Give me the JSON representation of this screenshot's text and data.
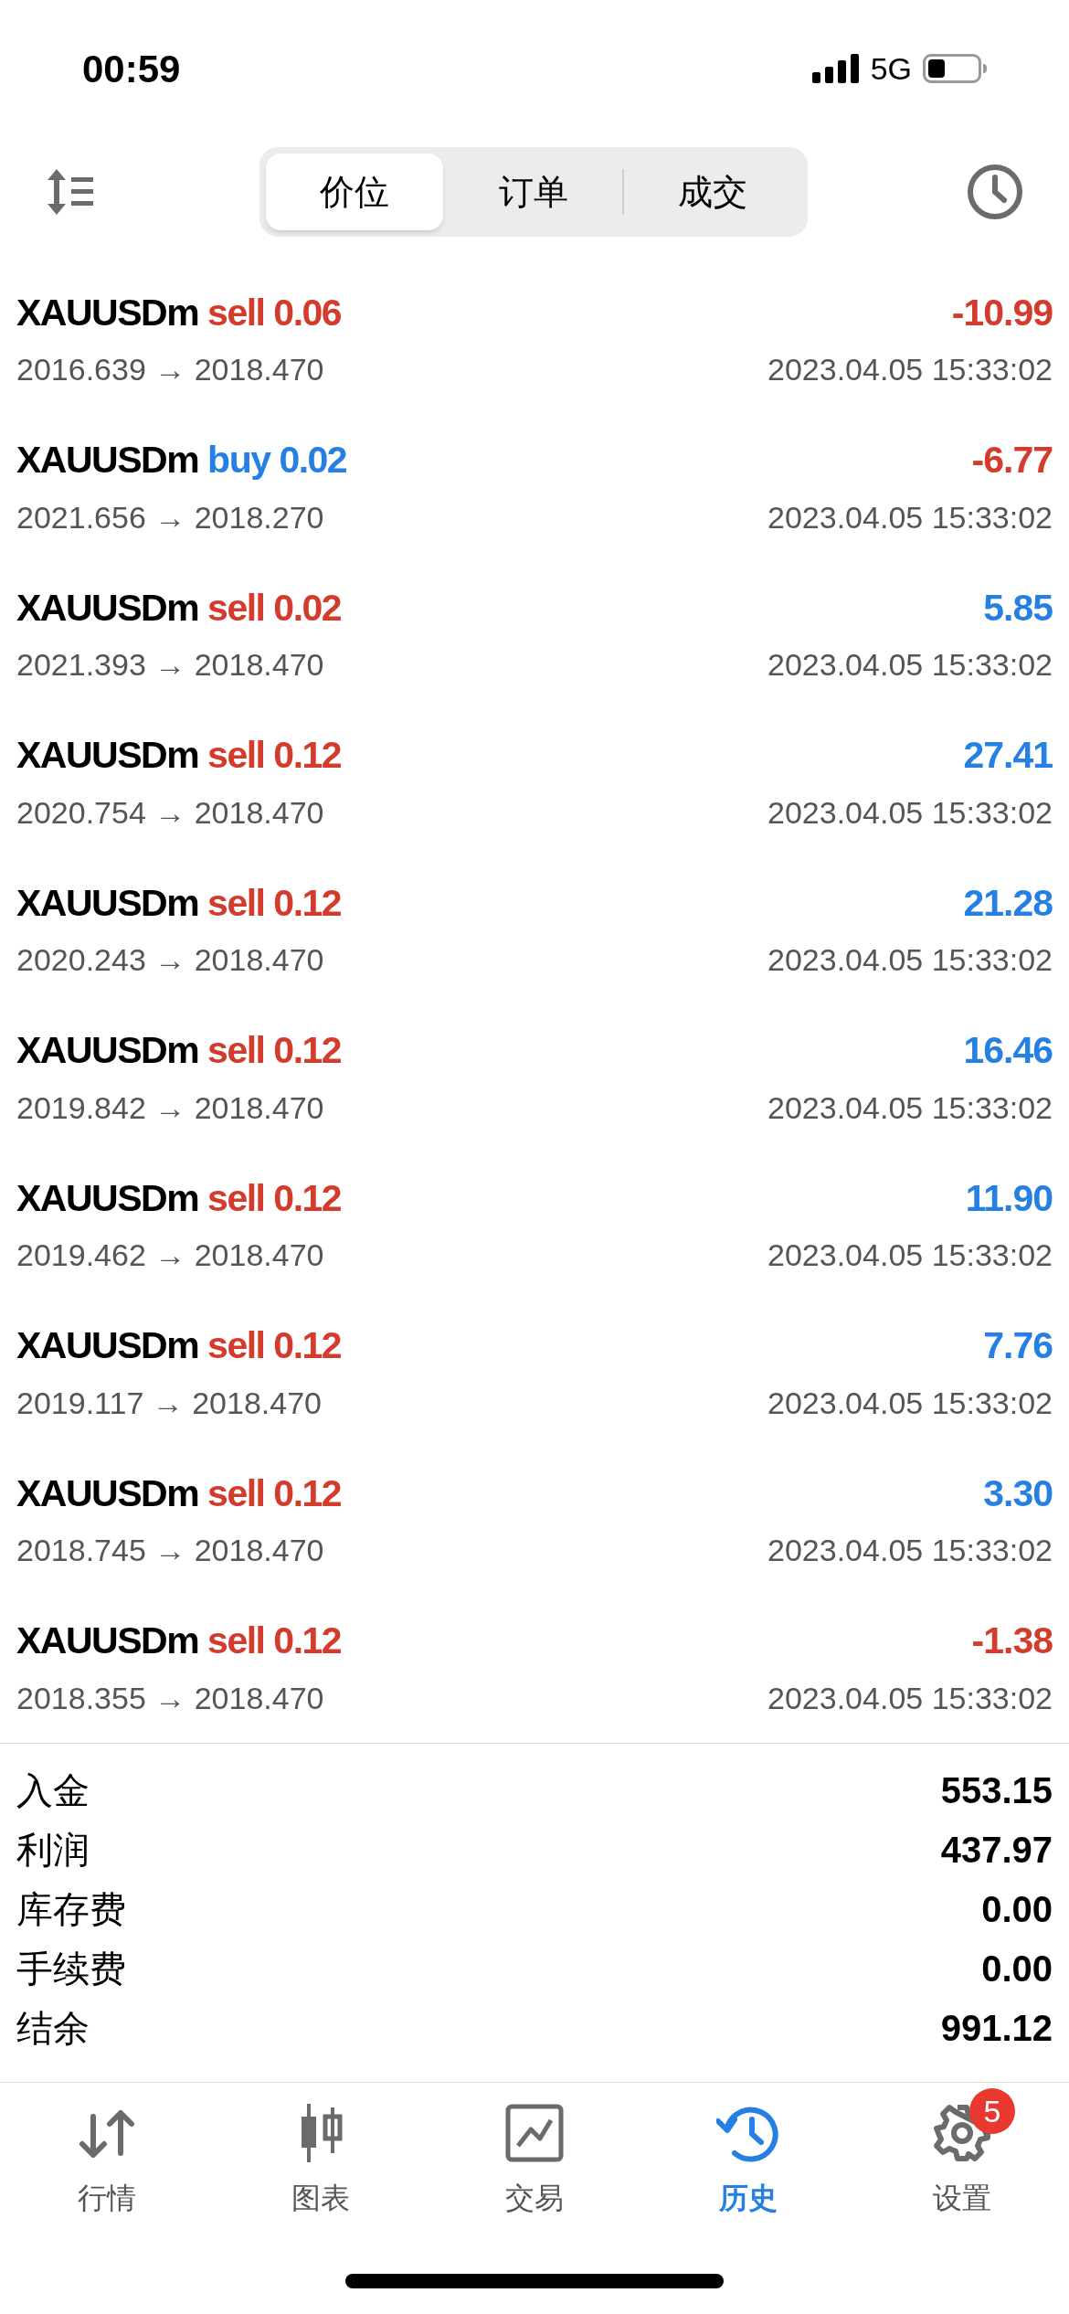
{
  "status_bar": {
    "time": "00:59",
    "network": "5G"
  },
  "tabs": [
    {
      "label": "价位",
      "selected": true
    },
    {
      "label": "订单",
      "selected": false
    },
    {
      "label": "成交",
      "selected": false
    }
  ],
  "deals": [
    {
      "symbol": "XAUUSDm",
      "direction": {
        "text": "sell 0.06",
        "color": "#d33b2c"
      },
      "prices": "2016.639 → 2018.470",
      "time": "2023.04.05 15:33:02",
      "profit": {
        "text": "-10.99",
        "color": "#d33b2c"
      }
    },
    {
      "symbol": "XAUUSDm",
      "direction": {
        "text": "buy 0.02",
        "color": "#2680e3"
      },
      "prices": "2021.656 → 2018.270",
      "time": "2023.04.05 15:33:02",
      "profit": {
        "text": "-6.77",
        "color": "#d33b2c"
      }
    },
    {
      "symbol": "XAUUSDm",
      "direction": {
        "text": "sell 0.02",
        "color": "#d33b2c"
      },
      "prices": "2021.393 → 2018.470",
      "time": "2023.04.05 15:33:02",
      "profit": {
        "text": "5.85",
        "color": "#2680e3"
      }
    },
    {
      "symbol": "XAUUSDm",
      "direction": {
        "text": "sell 0.12",
        "color": "#d33b2c"
      },
      "prices": "2020.754 → 2018.470",
      "time": "2023.04.05 15:33:02",
      "profit": {
        "text": "27.41",
        "color": "#2680e3"
      }
    },
    {
      "symbol": "XAUUSDm",
      "direction": {
        "text": "sell 0.12",
        "color": "#d33b2c"
      },
      "prices": "2020.243 → 2018.470",
      "time": "2023.04.05 15:33:02",
      "profit": {
        "text": "21.28",
        "color": "#2680e3"
      }
    },
    {
      "symbol": "XAUUSDm",
      "direction": {
        "text": "sell 0.12",
        "color": "#d33b2c"
      },
      "prices": "2019.842 → 2018.470",
      "time": "2023.04.05 15:33:02",
      "profit": {
        "text": "16.46",
        "color": "#2680e3"
      }
    },
    {
      "symbol": "XAUUSDm",
      "direction": {
        "text": "sell 0.12",
        "color": "#d33b2c"
      },
      "prices": "2019.462 → 2018.470",
      "time": "2023.04.05 15:33:02",
      "profit": {
        "text": "11.90",
        "color": "#2680e3"
      }
    },
    {
      "symbol": "XAUUSDm",
      "direction": {
        "text": "sell 0.12",
        "color": "#d33b2c"
      },
      "prices": "2019.117 → 2018.470",
      "time": "2023.04.05 15:33:02",
      "profit": {
        "text": "7.76",
        "color": "#2680e3"
      }
    },
    {
      "symbol": "XAUUSDm",
      "direction": {
        "text": "sell 0.12",
        "color": "#d33b2c"
      },
      "prices": "2018.745 → 2018.470",
      "time": "2023.04.05 15:33:02",
      "profit": {
        "text": "3.30",
        "color": "#2680e3"
      }
    },
    {
      "symbol": "XAUUSDm",
      "direction": {
        "text": "sell 0.12",
        "color": "#d33b2c"
      },
      "prices": "2018.355 → 2018.470",
      "time": "2023.04.05 15:33:02",
      "profit": {
        "text": "-1.38",
        "color": "#d33b2c"
      }
    }
  ],
  "summary": [
    {
      "label": "入金",
      "value": "553.15"
    },
    {
      "label": "利润",
      "value": "437.97"
    },
    {
      "label": "库存费",
      "value": "0.00"
    },
    {
      "label": "手续费",
      "value": "0.00"
    },
    {
      "label": "结余",
      "value": "991.12"
    }
  ],
  "bottom_nav": [
    {
      "kind": "quotes",
      "label": "行情",
      "selected": false
    },
    {
      "kind": "chart",
      "label": "图表",
      "selected": false
    },
    {
      "kind": "trade",
      "label": "交易",
      "selected": false
    },
    {
      "kind": "history",
      "label": "历史",
      "selected": true
    },
    {
      "kind": "settings",
      "label": "设置",
      "selected": false,
      "badge": "5"
    }
  ]
}
